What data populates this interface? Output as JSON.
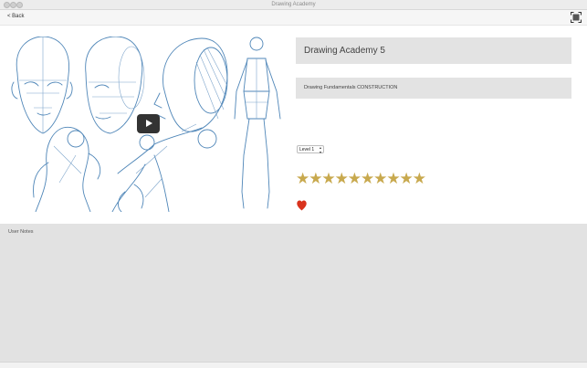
{
  "window": {
    "title": "Drawing Academy"
  },
  "nav": {
    "back_label": "< Back"
  },
  "lesson": {
    "title": "Drawing Academy 5",
    "subtitle": "Drawing Fundamentals CONSTRUCTION",
    "level": {
      "selected": "Level 1"
    },
    "rating": {
      "stars": 10,
      "max": 10,
      "color": "#c8a94e"
    },
    "favorite": {
      "icon": "heart-icon",
      "active": true,
      "color": "#d9331d"
    }
  },
  "notes": {
    "label": "User Notes"
  },
  "colors": {
    "notes_bg": "#e2e2e2",
    "title_box_bg": "#e3e3e3",
    "sketch": "#4f86b8"
  }
}
